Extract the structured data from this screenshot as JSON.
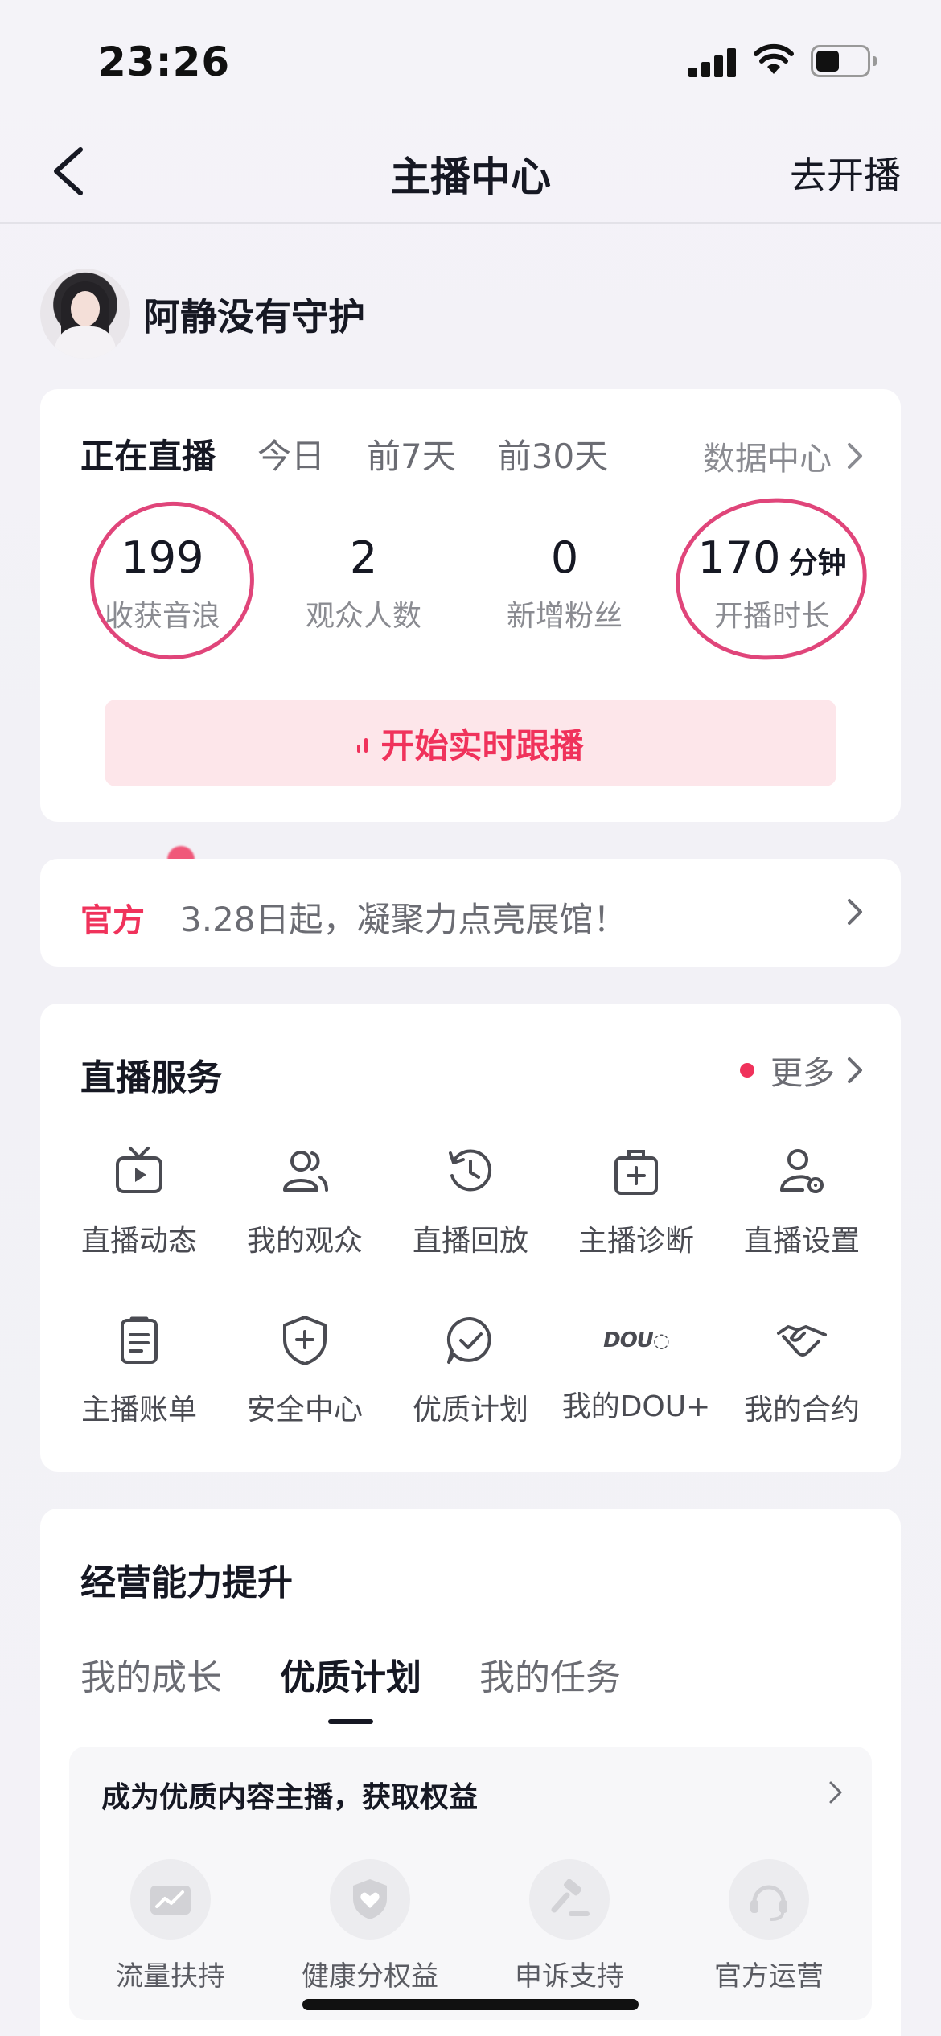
{
  "status_bar": {
    "time": "23:26"
  },
  "nav": {
    "title": "主播中心",
    "right_action": "去开播"
  },
  "user": {
    "name": "阿静没有守护"
  },
  "stats_card": {
    "tabs": [
      "正在直播",
      "今日",
      "前7天",
      "前30天"
    ],
    "active_tab": "正在直播",
    "data_center": "数据中心",
    "stats": [
      {
        "value": "199",
        "unit": "",
        "label": "收获音浪"
      },
      {
        "value": "2",
        "unit": "",
        "label": "观众人数"
      },
      {
        "value": "0",
        "unit": "",
        "label": "新增粉丝"
      },
      {
        "value": "170",
        "unit": "分钟",
        "label": "开播时长"
      }
    ],
    "follow_button": "开始实时跟播"
  },
  "announcement": {
    "tag": "官方",
    "text": "3.28日起，凝聚力点亮展馆！"
  },
  "services": {
    "title": "直播服务",
    "more": "更多",
    "items": [
      {
        "label": "直播动态",
        "icon": "tv-play-icon"
      },
      {
        "label": "我的观众",
        "icon": "users-icon"
      },
      {
        "label": "直播回放",
        "icon": "replay-clock-icon"
      },
      {
        "label": "主播诊断",
        "icon": "medical-kit-icon"
      },
      {
        "label": "直播设置",
        "icon": "user-settings-icon"
      },
      {
        "label": "主播账单",
        "icon": "clipboard-icon"
      },
      {
        "label": "安全中心",
        "icon": "shield-plus-icon"
      },
      {
        "label": "优质计划",
        "icon": "chat-check-icon"
      },
      {
        "label": "我的DOU+",
        "icon": "dou-plus-icon"
      },
      {
        "label": "我的合约",
        "icon": "handshake-icon"
      }
    ],
    "dou_logo_text": "DOU"
  },
  "growth": {
    "title": "经营能力提升",
    "tabs": [
      "我的成长",
      "优质计划",
      "我的任务"
    ],
    "active_tab": "优质计划",
    "banner_title": "成为优质内容主播，获取权益",
    "benefits": [
      {
        "label": "流量扶持",
        "icon": "traffic-chart-icon"
      },
      {
        "label": "健康分权益",
        "icon": "shield-heart-icon"
      },
      {
        "label": "申诉支持",
        "icon": "gavel-icon"
      },
      {
        "label": "官方运营",
        "icon": "headset-icon"
      }
    ]
  },
  "colors": {
    "accent": "#f0325b",
    "circle_annotation": "#e0457a",
    "text": "#161823",
    "muted": "#8a8b91"
  }
}
